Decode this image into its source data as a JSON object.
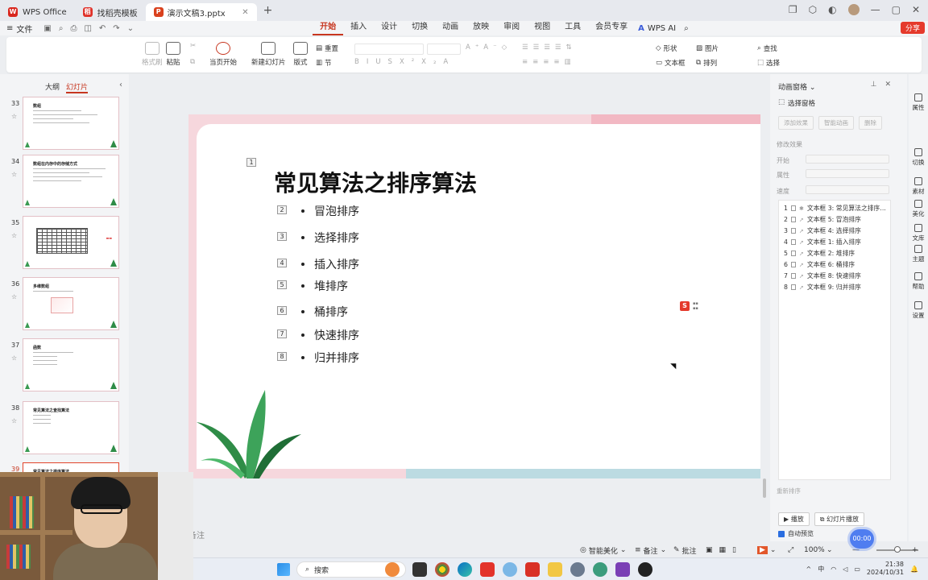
{
  "tabs": [
    {
      "label": "WPS Office",
      "icon": "wps-logo-icon"
    },
    {
      "label": "找稻壳模板",
      "icon": "template-logo-icon"
    },
    {
      "label": "演示文稿3.pptx",
      "icon": "ppt-logo-icon",
      "active": true
    }
  ],
  "menubar": {
    "file_label": "文件",
    "items": [
      "开始",
      "插入",
      "设计",
      "切换",
      "动画",
      "放映",
      "审阅",
      "视图",
      "工具",
      "会员专享"
    ],
    "active": "开始",
    "wps_ai_label": "WPS AI",
    "share_label": "分享"
  },
  "ribbon": {
    "format_painter": "格式刷",
    "paste": "粘贴",
    "from_current": "当页开始",
    "new_slide": "新建幻灯片",
    "layout": "版式",
    "reset": "重置",
    "section": "节",
    "shape": "形状",
    "picture": "图片",
    "textbox": "文本框",
    "arrange": "排列",
    "find": "查找",
    "select": "选择"
  },
  "left_panel": {
    "tabs": [
      "大纲",
      "幻灯片"
    ],
    "active_tab": "幻灯片",
    "thumbnails": [
      {
        "num": "33",
        "title": "数组"
      },
      {
        "num": "34",
        "title": "数组在内存中的存储方式"
      },
      {
        "num": "35",
        "title": ""
      },
      {
        "num": "36",
        "title": "多维数组"
      },
      {
        "num": "37",
        "title": "函数"
      },
      {
        "num": "38",
        "title": "常见算法之查找算法"
      },
      {
        "num": "39",
        "title": "常见算法之排序算法"
      }
    ]
  },
  "slide": {
    "title": "常见算法之排序算法",
    "title_tag": "1",
    "items": [
      {
        "tag": "2",
        "text": "冒泡排序"
      },
      {
        "tag": "3",
        "text": "选择排序"
      },
      {
        "tag": "4",
        "text": "插入排序"
      },
      {
        "tag": "5",
        "text": "堆排序"
      },
      {
        "tag": "6",
        "text": "桶排序"
      },
      {
        "tag": "7",
        "text": "快速排序"
      },
      {
        "tag": "8",
        "text": "归并排序"
      }
    ],
    "colors": {
      "pink": "#f6d7dd",
      "teal": "#bcdbe2",
      "leaf": "#2f8c47"
    }
  },
  "notes_placeholder": "备注",
  "animation_pane": {
    "title": "动画窗格",
    "select_pane": "选择窗格",
    "add_effect": "添加效果",
    "smart_animation": "智能动画",
    "delete": "删除",
    "modify_effect": "修改效果",
    "start_label": "开始",
    "property_label": "属性",
    "speed_label": "速度",
    "list": [
      {
        "num": "1",
        "text": "文本框 3: 常见算法之排序..."
      },
      {
        "num": "2",
        "text": "文本框 5: 冒泡排序"
      },
      {
        "num": "3",
        "text": "文本框 4: 选择排序"
      },
      {
        "num": "4",
        "text": "文本框 1: 插入排序"
      },
      {
        "num": "5",
        "text": "文本框 2: 堆排序"
      },
      {
        "num": "6",
        "text": "文本框 6: 桶排序"
      },
      {
        "num": "7",
        "text": "文本框 8: 快速排序"
      },
      {
        "num": "8",
        "text": "文本框 9: 归并排序"
      }
    ],
    "reorder": "重新排序",
    "play": "播放",
    "slideshow": "幻灯片播放",
    "auto_preview": "自动预览"
  },
  "side_toolbar": [
    "属性",
    "切换",
    "素材",
    "美化",
    "文库",
    "主题",
    "帮助",
    "设置"
  ],
  "statusbar": {
    "smart_beautify": "智能美化",
    "notes": "备注",
    "comments": "批注",
    "zoom": "100%",
    "timer": "00:00"
  },
  "taskbar": {
    "search_placeholder": "搜索",
    "time": "21:38",
    "date": "2024/10/31"
  }
}
